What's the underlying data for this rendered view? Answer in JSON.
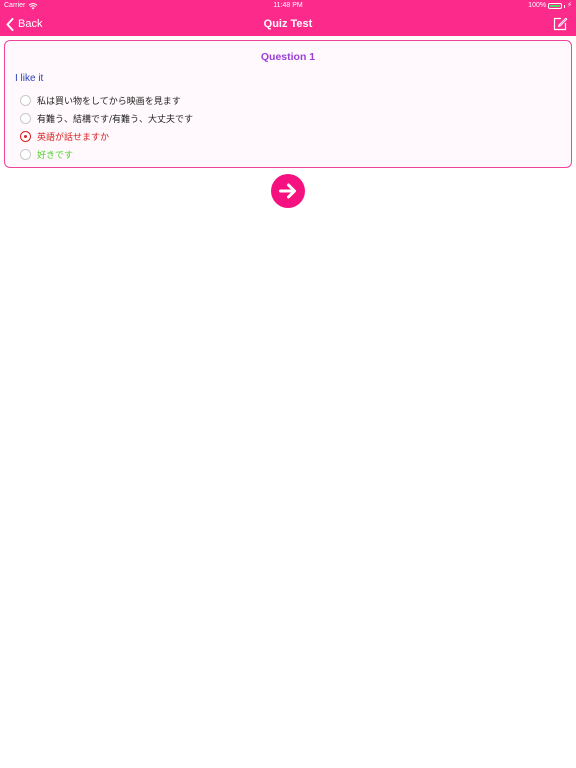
{
  "status_bar": {
    "carrier": "Carrier",
    "time": "11:48 PM",
    "battery": "100%",
    "icons": [
      "wifi-icon",
      "battery-icon",
      "charge-icon"
    ]
  },
  "navbar": {
    "back_label": "Back",
    "title": "Quiz Test",
    "edit_icon": "edit-icon"
  },
  "quiz": {
    "question_title": "Question 1",
    "question_text": "I like it",
    "options": [
      {
        "label": "私は買い物をしてから映画を見ます",
        "selected": false,
        "color": "#222222"
      },
      {
        "label": "有難う、結構です/有難う、大丈夫です",
        "selected": false,
        "color": "#222222"
      },
      {
        "label": "英語が話せますか",
        "selected": true,
        "color": "#d72222"
      },
      {
        "label": "好きです",
        "selected": false,
        "color": "#4bd42a"
      }
    ]
  },
  "next_button_icon": "arrow-right-icon",
  "colors": {
    "accent": "#fc2b8b",
    "next_button": "#f5117f",
    "question_title": "#9b3fd6",
    "question_text": "#2a41b9",
    "selected": "#d72222",
    "correct": "#4bd42a"
  }
}
